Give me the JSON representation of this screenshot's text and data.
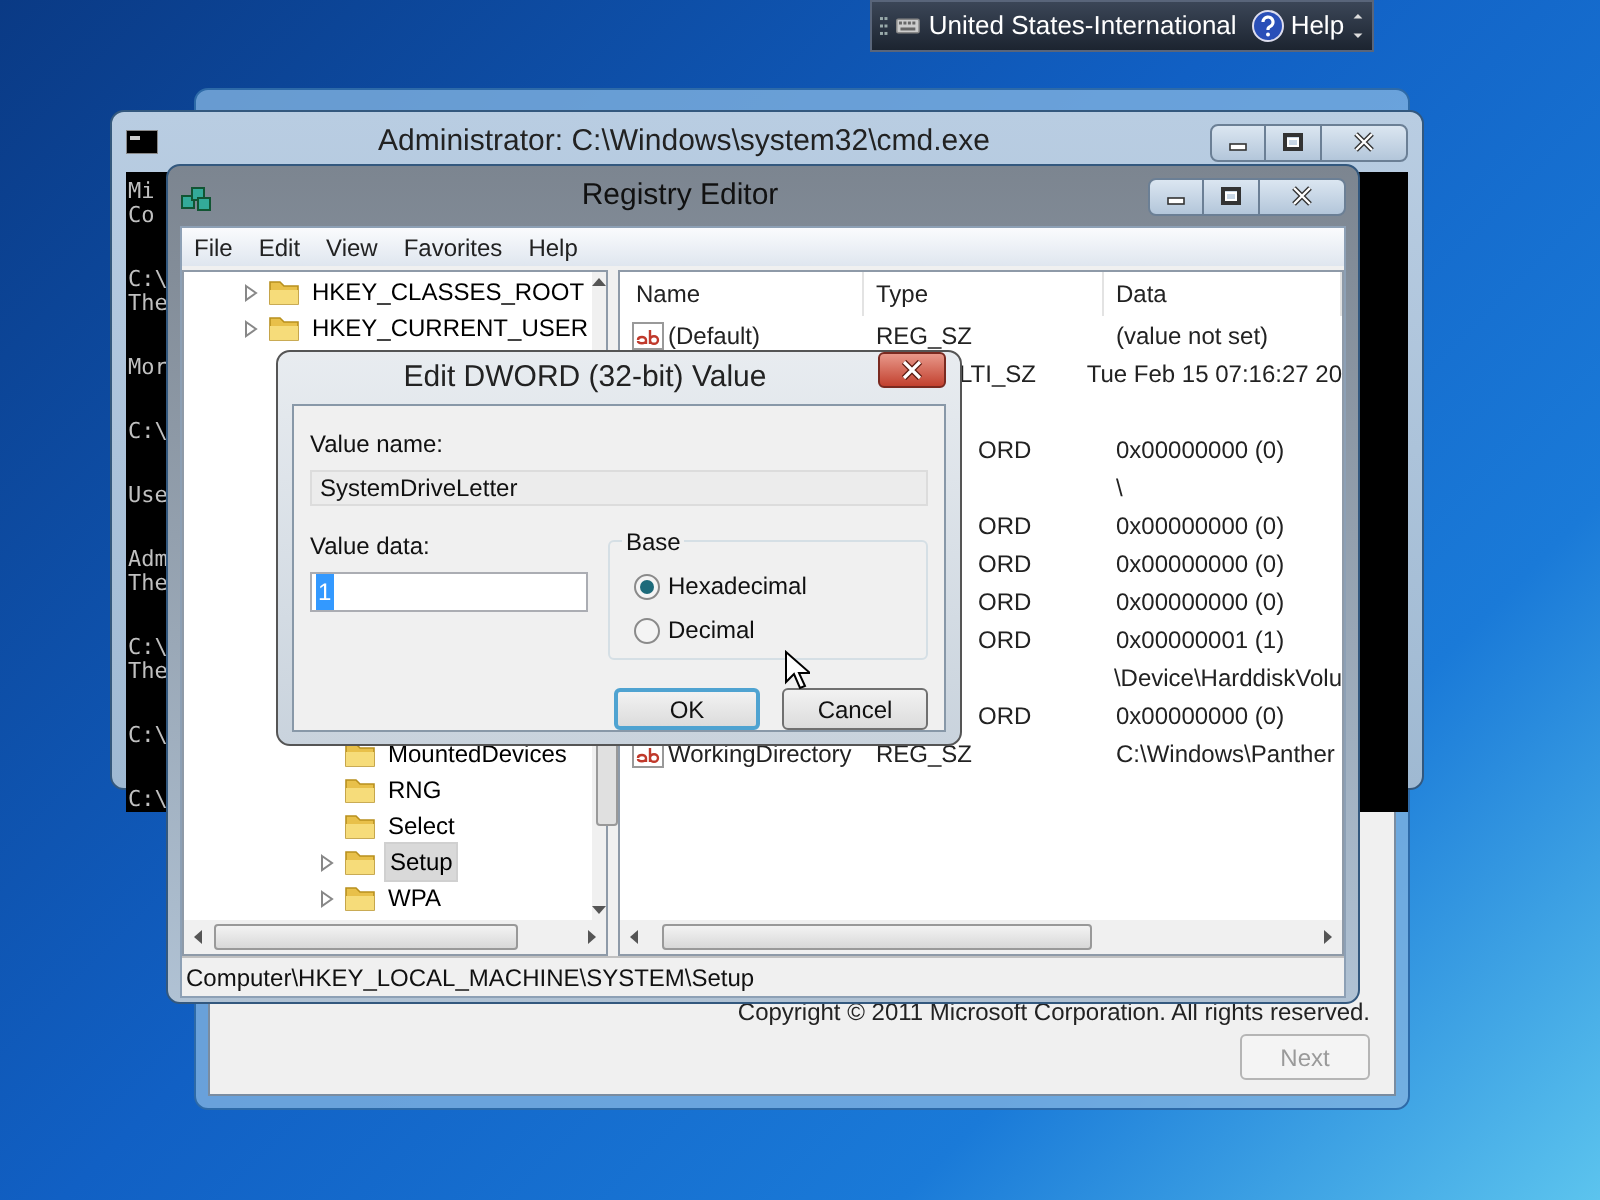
{
  "language_bar": {
    "layout": "United States-International",
    "help": "Help"
  },
  "setup_window": {
    "copyright": "Copyright © 2011 Microsoft Corporation. All rights reserved.",
    "next_button": {
      "label": "Next",
      "disabled": true
    }
  },
  "cmd_window": {
    "title": "Administrator: C:\\Windows\\system32\\cmd.exe",
    "console_blocks": [
      [
        "Mi",
        "Co"
      ],
      [
        "C:\\",
        "The"
      ],
      [
        "Mor"
      ],
      [
        "C:\\"
      ],
      [
        "Use"
      ],
      [
        "Adm",
        "The"
      ],
      [
        "C:\\",
        "The"
      ],
      [
        "C:\\"
      ],
      [
        "C:\\"
      ]
    ]
  },
  "regedit": {
    "title": "Registry Editor",
    "menu": [
      "File",
      "Edit",
      "View",
      "Favorites",
      "Help"
    ],
    "tree_top": [
      {
        "label": "HKEY_CLASSES_ROOT",
        "expandable": true,
        "selected": false
      },
      {
        "label": "HKEY_CURRENT_USER",
        "expandable": true,
        "selected": false
      }
    ],
    "tree_lower": [
      {
        "label": "MountedDevices",
        "expandable": false,
        "selected": false
      },
      {
        "label": "RNG",
        "expandable": false,
        "selected": false
      },
      {
        "label": "Select",
        "expandable": false,
        "selected": false
      },
      {
        "label": "Setup",
        "expandable": true,
        "selected": true
      },
      {
        "label": "WPA",
        "expandable": true,
        "selected": false
      }
    ],
    "columns": [
      "Name",
      "Type",
      "Data"
    ],
    "rows": [
      {
        "kind": "visible",
        "name": "(Default)",
        "type": "REG_SZ",
        "data": "(value not set)"
      },
      {
        "kind": "covered",
        "type": "LTI_SZ",
        "data": "Tue Feb 15 07:16:27 20"
      },
      {
        "kind": "covered"
      },
      {
        "kind": "covered",
        "type": "ORD",
        "data": "0x00000000 (0)"
      },
      {
        "kind": "covered",
        "data": "\\"
      },
      {
        "kind": "covered",
        "type": "ORD",
        "data": "0x00000000 (0)"
      },
      {
        "kind": "covered",
        "type": "ORD",
        "data": "0x00000000 (0)"
      },
      {
        "kind": "covered",
        "type": "ORD",
        "data": "0x00000000 (0)"
      },
      {
        "kind": "covered",
        "type": "ORD",
        "data": "0x00000001 (1)"
      },
      {
        "kind": "covered",
        "data": "\\Device\\HarddiskVolu"
      },
      {
        "kind": "covered",
        "type": "ORD",
        "data": "0x00000000 (0)"
      },
      {
        "kind": "visible",
        "name": "WorkingDirectory",
        "type": "REG_SZ",
        "data": "C:\\Windows\\Panther"
      }
    ],
    "status_bar": "Computer\\HKEY_LOCAL_MACHINE\\SYSTEM\\Setup"
  },
  "dialog": {
    "title": "Edit DWORD (32-bit) Value",
    "value_name_label": "Value name:",
    "value_name": "SystemDriveLetter",
    "value_data_label": "Value data:",
    "value_data": "1",
    "base_label": "Base",
    "bases": [
      {
        "label": "Hexadecimal",
        "selected": true
      },
      {
        "label": "Decimal",
        "selected": false
      }
    ],
    "buttons": [
      {
        "label": "OK",
        "default": true
      },
      {
        "label": "Cancel",
        "default": false
      }
    ]
  }
}
